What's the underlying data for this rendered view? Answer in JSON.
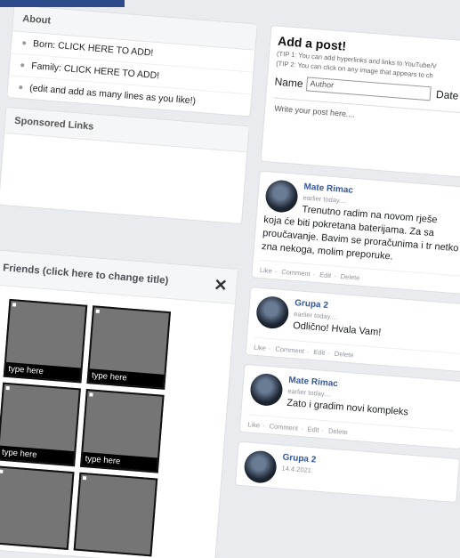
{
  "about": {
    "title": "About",
    "lines": [
      "Born: CLICK HERE TO ADD!",
      "Family: CLICK HERE TO ADD!",
      "(edit and add as many lines as you like!)"
    ]
  },
  "sponsored": {
    "title": "Sponsored Links"
  },
  "friends": {
    "title": "Friends (click here to change title)",
    "close_glyph": "✕",
    "captions": [
      "type here",
      "type here",
      "type here",
      "type here",
      "",
      ""
    ]
  },
  "add_post": {
    "title": "Add a post!",
    "tip1": "(TIP 1: You can add hyperlinks and links to YouTube/V",
    "tip2": "(TIP 2: You can click on any image that appears to ch",
    "name_label": "Name",
    "name_placeholder": "Author",
    "date_label": "Date",
    "post_placeholder": "Write your post here...."
  },
  "posts": [
    {
      "author": "Mate Rimac",
      "time": "earlier today....",
      "text_line1": "Trenutno radim na novom rješe",
      "text_rest": "koja će biti pokretana baterijama. Za sa proučavanje. Bavim se proračunima i tr netko zna nekoga, molim preporuke.",
      "actions": [
        "Like",
        "Comment",
        "Edit",
        "Delete"
      ]
    },
    {
      "author": "Grupa 2",
      "time": "earlier today....",
      "text": "Odlično! Hvala Vam!",
      "actions": [
        "Like",
        "Comment",
        "Edit",
        "Delete"
      ]
    },
    {
      "author": "Mate Rimac",
      "time": "earlier today....",
      "text": "Zato i gradim novi kompleks",
      "actions": [
        "Like",
        "Comment",
        "Edit",
        "Delete"
      ]
    },
    {
      "author": "Grupa 2",
      "time": "14.4.2021"
    }
  ],
  "action_separator": "·"
}
